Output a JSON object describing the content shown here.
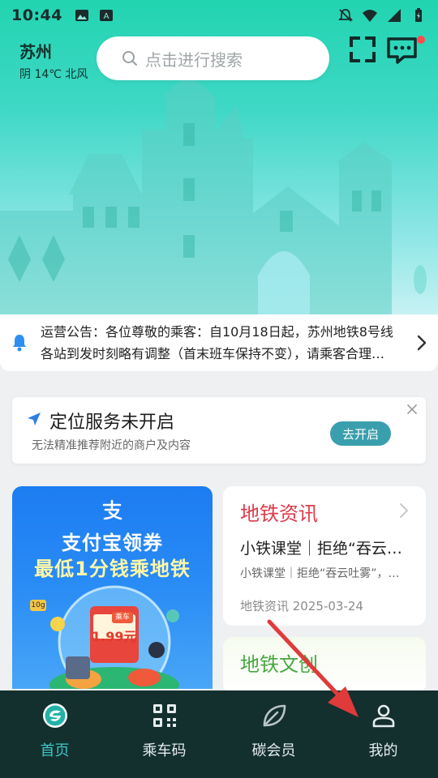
{
  "status_bar": {
    "time": "10:44"
  },
  "header": {
    "city": "苏州",
    "weather": "阴 14℃ 北风",
    "search_placeholder": "点击进行搜索"
  },
  "notice": {
    "text": "运营公告：各位尊敬的乘客：自10月18日起，苏州地铁8号线各站到发时刻略有调整（首末班车保持不变），请乘客合理安排出行。"
  },
  "location_card": {
    "title": "定位服务未开启",
    "subtitle": "无法精准推荐附近的商户及内容",
    "button_label": "去开启"
  },
  "promo": {
    "line1": "支付宝领券",
    "line2": "最低1分钱乘地铁",
    "price": "1.99元",
    "tag": "乘车",
    "badge": "10g"
  },
  "news_card": {
    "title": "地铁资讯",
    "headline": "小铁课堂｜拒绝“吞云吐雾”",
    "summary": "小铁课堂｜拒绝“吞云吐雾”，文明乘车",
    "meta": "地铁资讯 2025-03-24"
  },
  "culture_card": {
    "title": "地铁文创"
  },
  "bottom_nav": {
    "items": [
      {
        "label": "首页",
        "icon": "home-logo-icon",
        "active": true
      },
      {
        "label": "乘车码",
        "icon": "qr-code-icon",
        "active": false
      },
      {
        "label": "碳会员",
        "icon": "leaf-icon",
        "active": false
      },
      {
        "label": "我的",
        "icon": "user-icon",
        "active": false
      }
    ]
  },
  "colors": {
    "accent": "#3fc8c4",
    "nav_bg": "#13302f",
    "news_title": "#e0394a",
    "culture_title": "#46a83f",
    "button": "#3a9fad",
    "annotation_arrow": "#e03a3a"
  }
}
